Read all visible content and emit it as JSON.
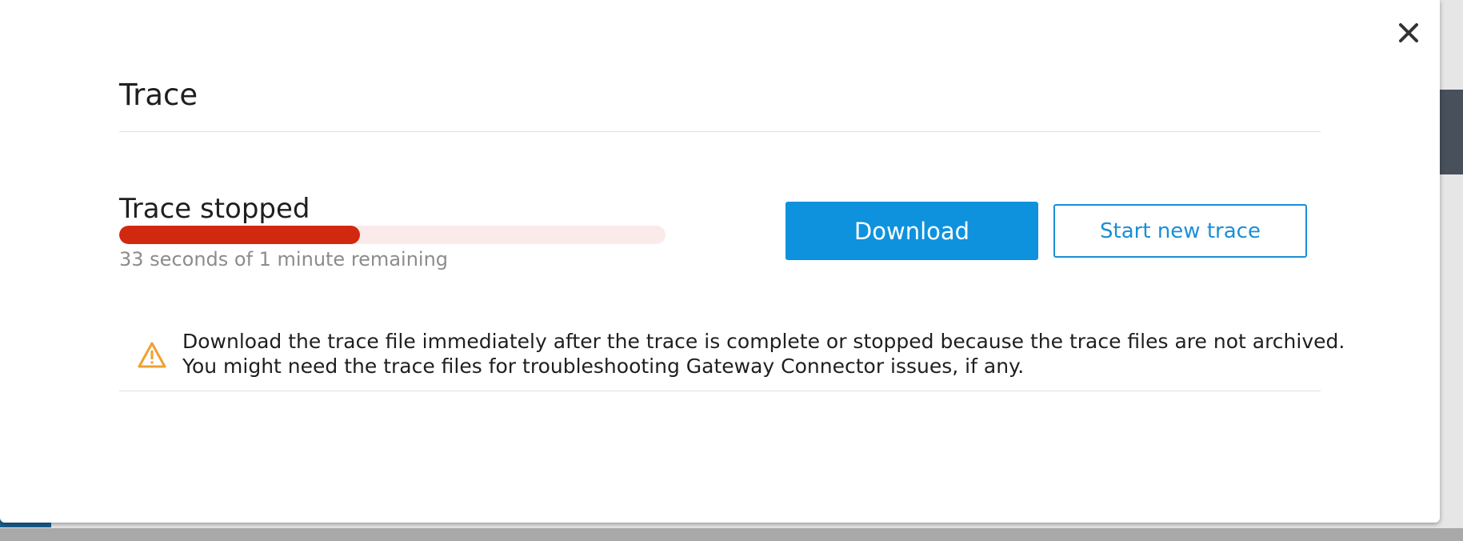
{
  "dialog": {
    "title": "Trace",
    "close_icon": "close-icon"
  },
  "trace": {
    "status": "Trace stopped",
    "progress_fraction": 0.44,
    "remaining_text": "33 seconds of 1 minute remaining"
  },
  "actions": {
    "download_label": "Download",
    "start_new_label": "Start new trace"
  },
  "warning": {
    "icon": "warning-icon",
    "line1": "Download the trace file immediately after the trace is complete or stopped because the trace files are not archived.",
    "line2": "You might need the trace files for troubleshooting Gateway Connector issues, if any."
  },
  "colors": {
    "accent": "#0e92de",
    "progress": "#d0290f",
    "warning": "#f0a030"
  }
}
